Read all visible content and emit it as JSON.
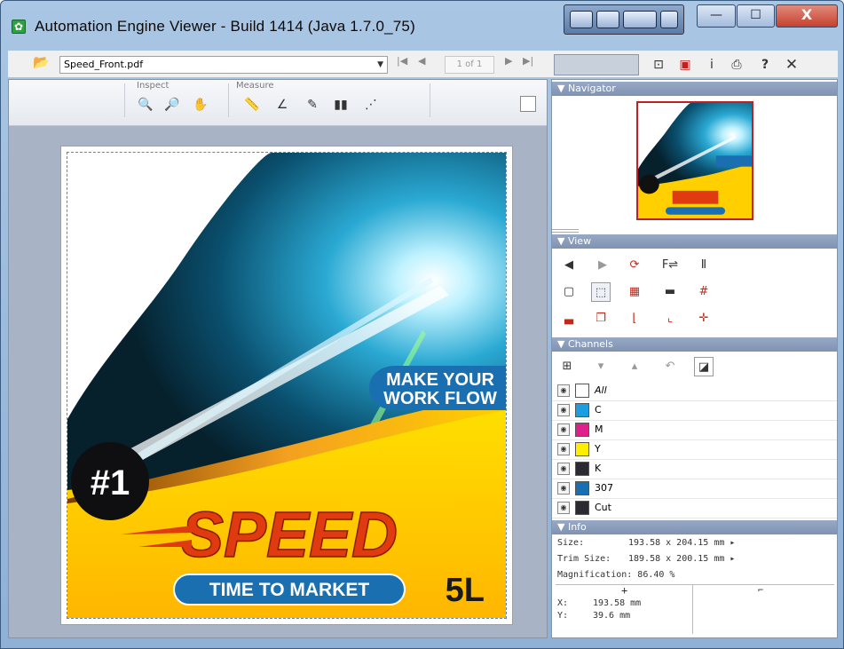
{
  "window": {
    "title": "Automation Engine Viewer - Build 1414 (Java 1.7.0_75)",
    "minimize_glyph": "—",
    "maximize_glyph": "☐",
    "close_glyph": "X"
  },
  "toolbar": {
    "file_name": "Speed_Front.pdf",
    "page_indicator": "1 of 1"
  },
  "tools": {
    "inspect_label": "Inspect",
    "measure_label": "Measure"
  },
  "artwork": {
    "headline_line1": "MAKE YOUR",
    "headline_line2": "WORK FLOW",
    "badge": "#1",
    "brand": "SPEED",
    "tagline": "TIME TO MARKET",
    "volume": "5L"
  },
  "side": {
    "navigator_title": "▼ Navigator",
    "view_title": "▼ View",
    "channels_title": "▼ Channels",
    "info_title": "▼ Info",
    "channels": [
      {
        "name": "All",
        "color": "#ffffff"
      },
      {
        "name": "C",
        "color": "#1a9ee0"
      },
      {
        "name": "M",
        "color": "#e0208a"
      },
      {
        "name": "Y",
        "color": "#ffee00"
      },
      {
        "name": "K",
        "color": "#2a2a30"
      },
      {
        "name": "307",
        "color": "#1a6fb0"
      },
      {
        "name": "Cut",
        "color": "#2a2a30"
      }
    ],
    "info": {
      "size_label": "Size:",
      "size_value": "193.58 x 204.15 mm ▸",
      "trim_label": "Trim Size:",
      "trim_value": "189.58 x 200.15 mm ▸",
      "magnification": "Magnification: 86.40 %",
      "x_label": "X:",
      "x_value": "193.58 mm",
      "y_label": "Y:",
      "y_value": "39.6 mm"
    }
  },
  "colors": {
    "accent_blue": "#1a6fb0",
    "speed_red": "#e03a10",
    "ribbon_yellow": "#ffd200"
  }
}
